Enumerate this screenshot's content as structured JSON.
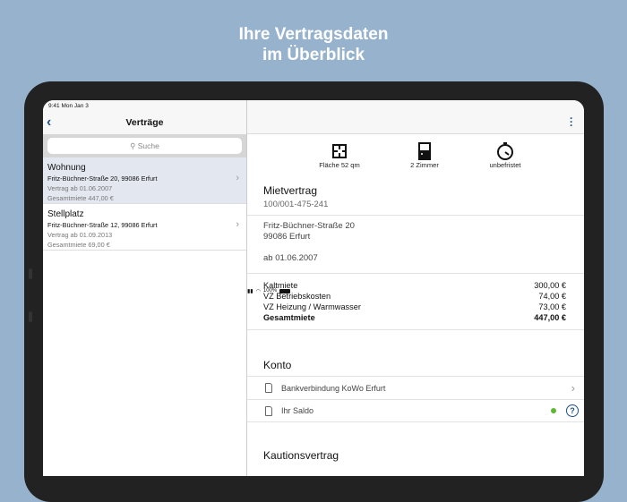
{
  "headline": {
    "line1": "Ihre Vertragsdaten",
    "line2": "im Überblick"
  },
  "status": {
    "time": "9:41 Mon Jan 3",
    "battery": "100%"
  },
  "left": {
    "title": "Verträge",
    "search_placeholder": "Suche",
    "items": [
      {
        "title": "Wohnung",
        "address": "Fritz-Büchner-Straße 20, 99086 Erfurt",
        "since": "Vertrag ab 01.06.2007",
        "total": "Gesamtmiete 447,00 €"
      },
      {
        "title": "Stellplatz",
        "address": "Fritz-Büchner-Straße 12, 99086 Erfurt",
        "since": "Vertrag ab 01.09.2013",
        "total": "Gesamtmiete 69,00 €"
      }
    ]
  },
  "detail": {
    "features": [
      {
        "icon": "floorplan-icon",
        "label": "Fläche 52 qm"
      },
      {
        "icon": "door-icon",
        "label": "2 Zimmer"
      },
      {
        "icon": "stopwatch-icon",
        "label": "unbefristet"
      }
    ],
    "contract_title": "Mietvertrag",
    "contract_number": "100/001-475-241",
    "street": "Fritz-Büchner-Straße 20",
    "city": "99086 Erfurt",
    "since": "ab 01.06.2007",
    "costs": [
      {
        "label": "Kaltmiete",
        "value": "300,00 €"
      },
      {
        "label": "VZ Betriebskosten",
        "value": "74,00 €"
      },
      {
        "label": "VZ Heizung / Warmwasser",
        "value": "73,00 €"
      },
      {
        "label": "Gesamtmiete",
        "value": "447,00 €"
      }
    ],
    "account_title": "Konto",
    "bank": "Bankverbindung KoWo Erfurt",
    "balance": "Ihr Saldo",
    "balance_status_color": "#5cb82e",
    "deposit_title": "Kautionsvertrag"
  }
}
